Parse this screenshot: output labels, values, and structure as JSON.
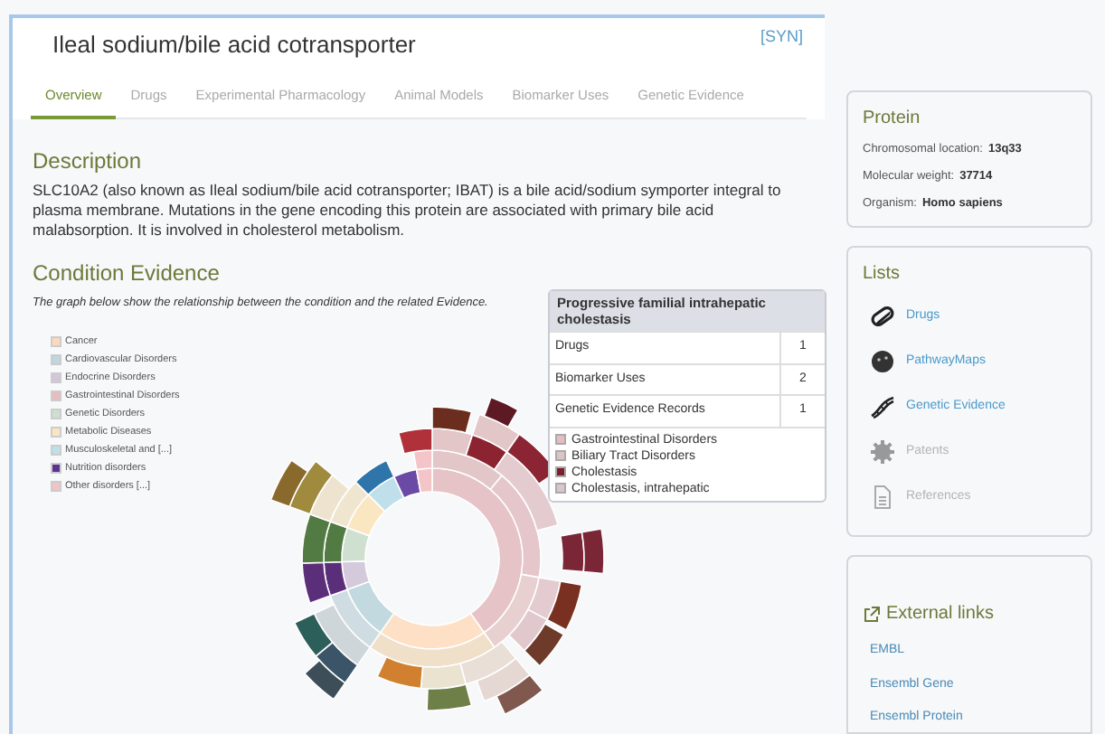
{
  "title": "Ileal sodium/bile acid cotransporter",
  "syn": "[SYN]",
  "tabs": [
    {
      "label": "Overview",
      "selected": true
    },
    {
      "label": "Drugs",
      "selected": false
    },
    {
      "label": "Experimental Pharmacology",
      "selected": false
    },
    {
      "label": "Animal Models",
      "selected": false
    },
    {
      "label": "Biomarker Uses",
      "selected": false
    },
    {
      "label": "Genetic Evidence",
      "selected": false
    }
  ],
  "description": {
    "heading": "Description",
    "text": "SLC10A2 (also known as Ileal sodium/bile acid cotransporter; IBAT) is a bile acid/sodium symporter integral to plasma membrane. Mutations in the gene encoding this protein are associated with primary bile acid malabsorption. It is involved in cholesterol metabolism."
  },
  "condition_evidence": {
    "heading": "Condition Evidence",
    "note": "The graph below show the relationship between the condition and the related Evidence.",
    "legend": [
      {
        "label": "Cancer",
        "color": "#fcd9bd"
      },
      {
        "label": "Cardiovascular Disorders",
        "color": "#bfd6de"
      },
      {
        "label": "Endocrine Disorders",
        "color": "#d3c6dc"
      },
      {
        "label": "Gastrointestinal Disorders",
        "color": "#e6bcc0"
      },
      {
        "label": "Genetic Disorders",
        "color": "#cde0cf"
      },
      {
        "label": "Metabolic Diseases",
        "color": "#fbe5c0"
      },
      {
        "label": "Musculoskeletal and [...]",
        "color": "#bde0ea"
      },
      {
        "label": "Nutrition disorders",
        "color": "#5a3495"
      },
      {
        "label": "Other disorders [...]",
        "color": "#f4c2c5"
      }
    ],
    "tooltip": {
      "title": "Progressive familial intrahepatic cholestasis",
      "rows": [
        {
          "label": "Drugs",
          "value": "1"
        },
        {
          "label": "Biomarker Uses",
          "value": "2"
        },
        {
          "label": "Genetic Evidence Records",
          "value": "1"
        }
      ],
      "legend": [
        {
          "label": "Gastrointestinal Disorders",
          "color": "#e6bcc0"
        },
        {
          "label": "Biliary Tract Disorders",
          "color": "#dcc4c6"
        },
        {
          "label": "Cholestasis",
          "color": "#7a1f2b"
        },
        {
          "label": "Cholestasis, intrahepatic",
          "color": "#dcc4cc"
        }
      ]
    }
  },
  "protein": {
    "heading": "Protein",
    "fields": [
      {
        "label": "Chromosomal location:",
        "value": "13q33"
      },
      {
        "label": "Molecular weight:",
        "value": "37714"
      },
      {
        "label": "Organism:",
        "value": "Homo sapiens"
      }
    ]
  },
  "lists": {
    "heading": "Lists",
    "items": [
      {
        "kind": "pill",
        "label": "Drugs",
        "disabled": false
      },
      {
        "kind": "globe",
        "label": "PathwayMaps",
        "disabled": false
      },
      {
        "kind": "dna",
        "label": "Genetic Evidence",
        "disabled": false
      },
      {
        "kind": "gear",
        "label": "Patents",
        "disabled": true
      },
      {
        "kind": "document",
        "label": "References",
        "disabled": true
      }
    ]
  },
  "external_links": {
    "heading": "External links",
    "links": [
      "EMBL",
      "Ensembl Gene",
      "Ensembl Protein"
    ]
  }
}
